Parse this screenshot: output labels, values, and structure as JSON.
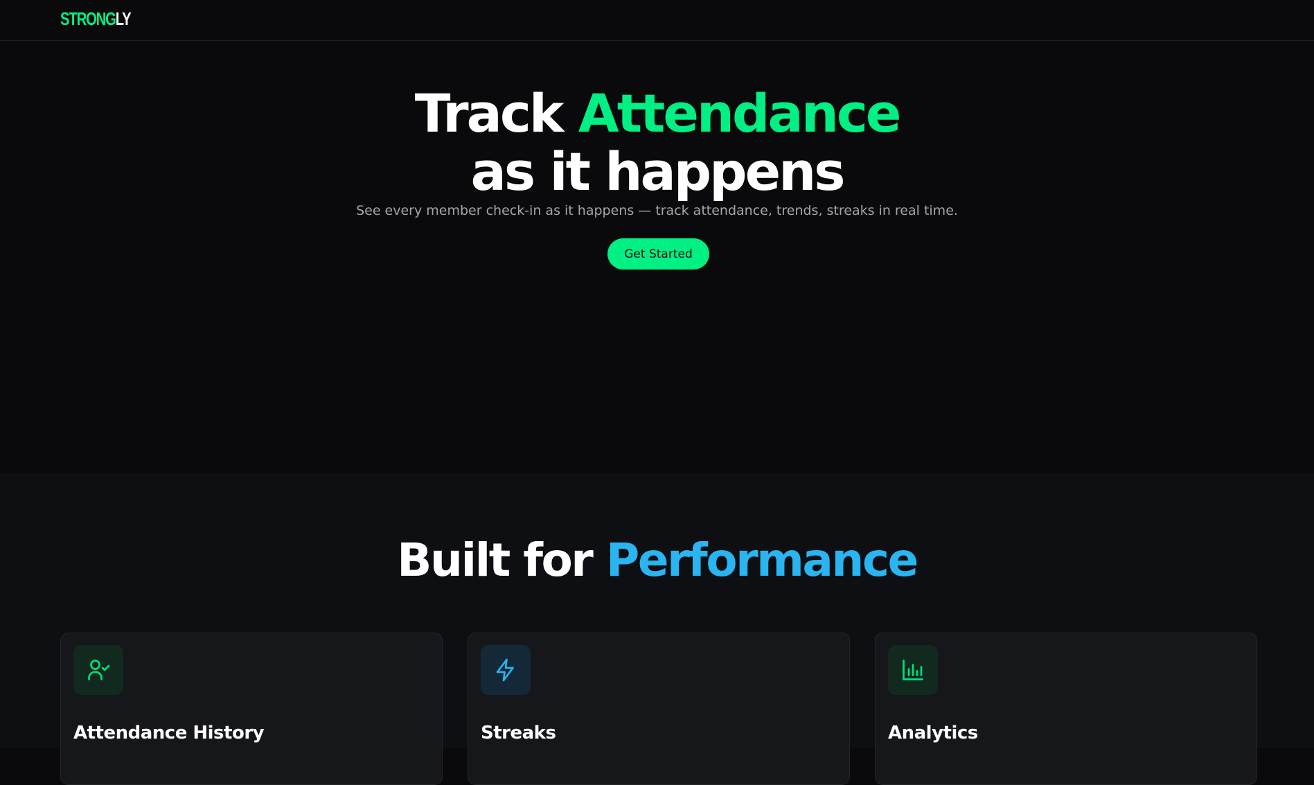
{
  "brand": {
    "logo_part1": "STRONG",
    "logo_part2": "LY",
    "accent_color": "#00f084",
    "secondary_accent": "#2ab4f0"
  },
  "hero": {
    "title_part1": "Track ",
    "title_highlight": "Attendance",
    "title_line2": "as it happens",
    "subtitle": "See every member check-in as it happens — track attendance, trends, streaks in real time.",
    "cta_label": "Get Started"
  },
  "features": {
    "title_part1": "Built for ",
    "title_highlight": "Performance",
    "cards": [
      {
        "title": "Attendance History",
        "icon": "user-check-icon"
      },
      {
        "title": "Streaks",
        "icon": "lightning-bolt-icon"
      },
      {
        "title": "Analytics",
        "icon": "bar-chart-icon"
      }
    ]
  }
}
